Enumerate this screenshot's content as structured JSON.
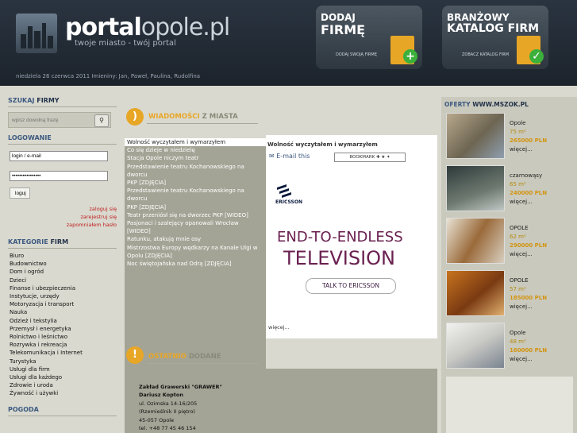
{
  "header": {
    "logo_bold": "portal",
    "logo_light": "opole.pl",
    "tagline": "twoje miasto - twój portal",
    "date_line": "niedziela 26 czerwca 2011  Imieniny: Jan, Paweł, Paulina, Rudolfina"
  },
  "promo_left": {
    "line1": "DODAJ",
    "line2": "FIRMĘ",
    "sub": "DODAJ SWOJĄ FIRMĘ"
  },
  "promo_right": {
    "line1": "BRANŻOWY",
    "line2": "KATALOG FIRM",
    "sub": "ZOBACZ KATALOG FIRM"
  },
  "search": {
    "title_light": "SZUKAJ",
    "title_bold": "FIRMY",
    "placeholder": "wpisz dowolną frazę"
  },
  "login": {
    "title": "LOGOWANIE",
    "login_value": "login / e-mail",
    "password_value": "••••••••••••••••",
    "button": "loguj",
    "links": [
      "zaloguj się",
      "zarejestruj się",
      "zapomniałem hasło"
    ]
  },
  "categories": {
    "title_light": "KATEGORIE",
    "title_bold": "FIRM",
    "items": [
      "Biuro",
      "Budownictwo",
      "Dom i ogród",
      "Dzieci",
      "Finanse i ubezpieczenia",
      "Instytucje, urzędy",
      "Motoryzacja i transport",
      "Nauka",
      "Odzież i tekstylia",
      "Przemysł i energetyka",
      "Rolnictwo i leśnictwo",
      "Rozrywka i rekreacja",
      "Telekomunikacja i Internet",
      "Turystyka",
      "Usługi dla firm",
      "Usługi dla każdego",
      "Zdrowie i uroda",
      "Żywność i używki"
    ]
  },
  "pogoda_title": "POGODA",
  "news": {
    "title_light": "WIADOMOŚCI",
    "title_bold": "Z MIASTA",
    "items": [
      "Wolność wyczytałem i wymarzyłem",
      "Co się dzieje w niedzielę",
      "Stacja Opole niczym teatr",
      "Przedstawienie teatru Kochanowskiego na dworcu",
      "PKP [ZDJĘCIA]",
      "Przedstawienie teatru Kochanowskiego na dworcu",
      "PKP [ZDJĘCIA]",
      "Teatr przeniósł się na dworzec PKP [WIDEO]",
      "Pasjonaci i szalejący opanowali Wrocław [WIDEO]",
      "Ratunku, atakują mnie osy",
      "Mistrzostwa Europy wędkarzy na Kanale Ulgi w",
      "Opolu [ZDJĘCIA]",
      "Noc świętojańska nad Odrą [ZDJĘCIA]"
    ],
    "featured_title": "Wolność wyczytałem i wymarzyłem",
    "email_label": "E-mail this",
    "bookmark_label": "BOOKMARK",
    "more": "więcej..."
  },
  "ad": {
    "brand": "ERICSSON",
    "line1": "END-TO-ENDLESS",
    "line2": "TELEVISION",
    "button": "TALK TO ERICSSON"
  },
  "recent": {
    "title_light": "OSTATNIO",
    "title_bold": "DODANE",
    "lines": [
      "Zakład Grawerski \"GRAWER\"",
      "Dariusz Kopton",
      "ul. Ozimska 14-16/205",
      "(Rzemieślnik II piętro)",
      "45-057 Opole",
      "tel. +48 77 45 46 154"
    ]
  },
  "offers": {
    "title_light": "OFERTY",
    "title_bold": "WWW.MSZOK.PL",
    "items": [
      {
        "city": "Opole",
        "area": "75 m²",
        "price": "265000 PLN",
        "more": "więcej..."
      },
      {
        "city": "czarnowąsy",
        "area": "65 m²",
        "price": "240000 PLN",
        "more": "więcej..."
      },
      {
        "city": "OPOLE",
        "area": "62 m²",
        "price": "290000 PLN",
        "more": "więcej..."
      },
      {
        "city": "OPOLE",
        "area": "57 m²",
        "price": "185000 PLN",
        "more": "więcej..."
      },
      {
        "city": "Opole",
        "area": "48 m²",
        "price": "160000 PLN",
        "more": "więcej..."
      }
    ]
  },
  "colors": {
    "accent_orange": "#e8a626",
    "link_red": "#c02020",
    "header_dark": "#1c232b",
    "green_check": "#3bb03b"
  }
}
